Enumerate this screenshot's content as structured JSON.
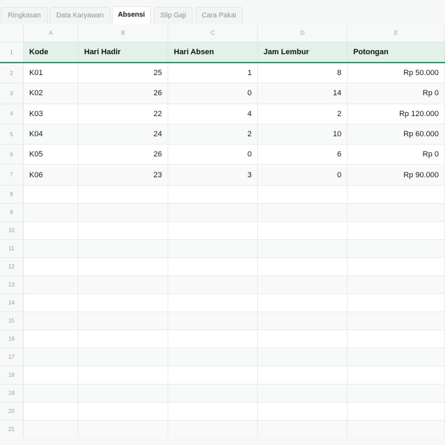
{
  "tabs": [
    {
      "label": "Ringkasan",
      "active": false
    },
    {
      "label": "Data Karyawan",
      "active": false
    },
    {
      "label": "Absensi",
      "active": true
    },
    {
      "label": "Slip Gaji",
      "active": false
    },
    {
      "label": "Cara Pakai",
      "active": false
    }
  ],
  "columns": [
    "A",
    "B",
    "C",
    "D",
    "E"
  ],
  "row_numbers": [
    "1",
    "2",
    "3",
    "4",
    "5",
    "6",
    "7",
    "8",
    "9",
    "10",
    "11",
    "12",
    "13",
    "14",
    "15",
    "16",
    "17",
    "18",
    "19",
    "20",
    "21"
  ],
  "table": {
    "headers": [
      "Kode",
      "Hari Hadir",
      "Hari Absen",
      "Jam Lembur",
      "Potongan"
    ],
    "rows": [
      [
        "K01",
        "25",
        "1",
        "8",
        "Rp 50.000"
      ],
      [
        "K02",
        "26",
        "0",
        "14",
        "Rp 0"
      ],
      [
        "K03",
        "22",
        "4",
        "2",
        "Rp 120.000"
      ],
      [
        "K04",
        "24",
        "2",
        "10",
        "Rp 60.000"
      ],
      [
        "K05",
        "26",
        "0",
        "6",
        "Rp 0"
      ],
      [
        "K06",
        "23",
        "3",
        "0",
        "Rp 90.000"
      ]
    ]
  },
  "colors": {
    "header_fill": "#e2f1ea",
    "header_underline": "#3f8f6c",
    "active_tab": "#ffffff"
  }
}
